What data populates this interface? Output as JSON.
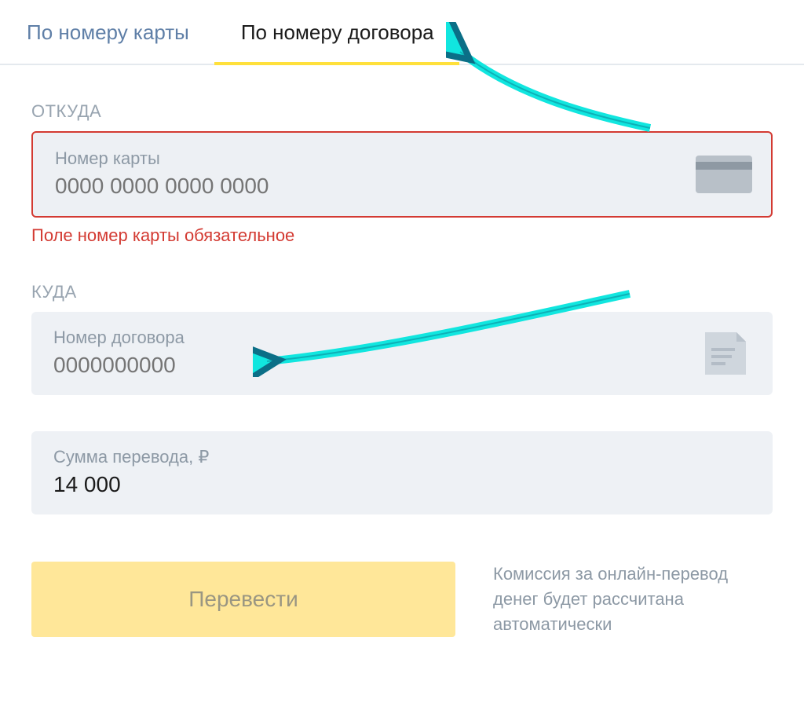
{
  "tabs": {
    "card": "По номеру карты",
    "contract": "По номеру договора"
  },
  "from": {
    "section": "ОТКУДА",
    "label": "Номер карты",
    "placeholder": "0000 0000 0000 0000",
    "error": "Поле номер карты обязательное"
  },
  "to": {
    "section": "КУДА",
    "label": "Номер договора",
    "placeholder": "0000000000"
  },
  "amount": {
    "label": "Сумма перевода, ₽",
    "value": "14 000"
  },
  "submit": {
    "button": "Перевести",
    "commission": "Комиссия за онлайн-перевод денег будет рассчитана автоматически"
  },
  "colors": {
    "accent_yellow": "#ffe03b",
    "button_yellow": "#ffe799",
    "error_red": "#d33a32",
    "arrow_cyan": "#11e6df"
  }
}
